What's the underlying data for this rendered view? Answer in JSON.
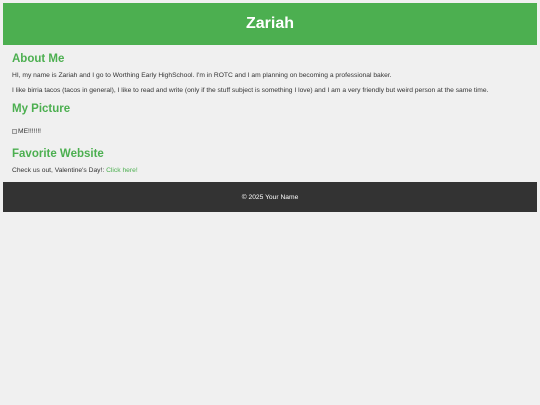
{
  "header": {
    "title": "Zariah"
  },
  "about": {
    "heading": "About Me",
    "paragraph1": "HI, my name is Zariah and I go to Worthing Early HighSchool. I'm in ROTC and I am planning on becoming a professional baker.",
    "paragraph2": "I like birria tacos (tacos in general), I like to read and write (only if the stuff subject is something I love) and I am a very friendly but weird person at the same time."
  },
  "picture": {
    "heading": "My Picture",
    "alt_text": "ME!!!!!!!"
  },
  "favorite": {
    "heading": "Favorite Website",
    "text": "Check us out, Valentine's Day!: ",
    "link_label": "Click here!"
  },
  "footer": {
    "text": "© 2025 Your Name"
  },
  "colors": {
    "accent": "#4caf50",
    "footer_bg": "#333333",
    "page_bg": "#f0f0f0"
  }
}
